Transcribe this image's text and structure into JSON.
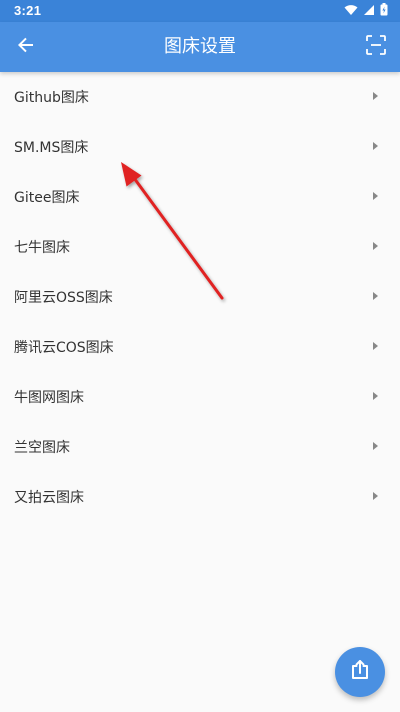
{
  "status_bar": {
    "time": "3:21",
    "icons": [
      "wifi-icon",
      "signal-icon",
      "battery-icon"
    ]
  },
  "app_bar": {
    "title": "图床设置",
    "back_icon": "arrow-back-icon",
    "action_icon": "scan-icon"
  },
  "list": {
    "items": [
      {
        "label": "Github图床"
      },
      {
        "label": "SM.MS图床"
      },
      {
        "label": "Gitee图床"
      },
      {
        "label": "七牛图床"
      },
      {
        "label": "阿里云OSS图床"
      },
      {
        "label": "腾讯云COS图床"
      },
      {
        "label": "牛图网图床"
      },
      {
        "label": "兰空图床"
      },
      {
        "label": "又拍云图床"
      }
    ]
  },
  "fab": {
    "icon": "upload-icon"
  },
  "colors": {
    "status_bar": "#3a83d8",
    "app_bar": "#4a90e2",
    "background": "#fafafa",
    "text": "#333333",
    "annotation_arrow": "#e02020",
    "fab": "#4a90e2"
  }
}
